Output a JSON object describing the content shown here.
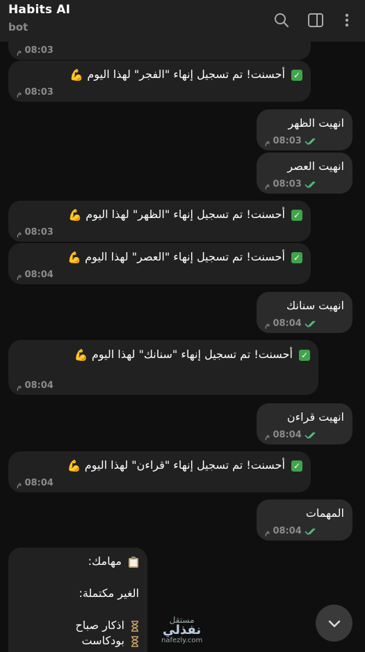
{
  "header": {
    "title": "Habits AI",
    "subtitle": "bot",
    "icons": [
      "search-icon",
      "sidebar-toggle-icon",
      "more-vert-icon"
    ]
  },
  "colors": {
    "background": "#0f0f0f",
    "header": "#212121",
    "incoming_bubble": "#212121",
    "outgoing_bubble": "#2b2b2b",
    "read_ticks": "#4fbe79",
    "check_emoji": "#3fa54a"
  },
  "messages": [
    {
      "dir": "in",
      "text": "",
      "time": "08:03",
      "ampm": "م"
    },
    {
      "dir": "in",
      "check": "✓",
      "text": "أحسنت! تم تسجيل إنهاء \"الفجر\" لهذا اليوم",
      "muscle": "💪",
      "time": "08:03",
      "ampm": "م"
    },
    {
      "dir": "out",
      "text": "انهيت الظهر",
      "time": "08:03",
      "ampm": "م"
    },
    {
      "dir": "out",
      "text": "انهيت العصر",
      "time": "08:03",
      "ampm": "م"
    },
    {
      "dir": "in",
      "check": "✓",
      "text": "أحسنت! تم تسجيل إنهاء \"الظهر\" لهذا اليوم",
      "muscle": "💪",
      "time": "08:03",
      "ampm": "م"
    },
    {
      "dir": "in",
      "check": "✓",
      "text": "أحسنت! تم تسجيل إنهاء \"العصر\" لهذا اليوم",
      "muscle": "💪",
      "time": "08:04",
      "ampm": "م"
    },
    {
      "dir": "out",
      "text": "انهيت سنانك",
      "time": "08:04",
      "ampm": "م"
    },
    {
      "dir": "in",
      "check": "✓",
      "text": "أحسنت! تم تسجيل إنهاء \"سنانك\" لهذا اليوم",
      "muscle": "💪",
      "time": "08:04",
      "ampm": "م"
    },
    {
      "dir": "out",
      "text": "انهيت قراءن",
      "time": "08:04",
      "ampm": "م"
    },
    {
      "dir": "in",
      "check": "✓",
      "text": "أحسنت! تم تسجيل إنهاء \"قراءن\" لهذا اليوم",
      "muscle": "💪",
      "time": "08:04",
      "ampm": "م"
    },
    {
      "dir": "out",
      "text": "المهمات",
      "time": "08:04",
      "ampm": "م"
    }
  ],
  "tasks_message": {
    "heading": "مهامك:",
    "heading_icon": "clipboard-icon",
    "subheading": "الغير مكتملة:",
    "items": [
      {
        "icon": "hourglass-icon",
        "label": "اذكار صباح"
      },
      {
        "icon": "hourglass-icon",
        "label": "بودكاست"
      }
    ]
  },
  "watermark": {
    "line1": "مستقل",
    "line2": "نفذلي",
    "line3": "nafezly.com"
  }
}
